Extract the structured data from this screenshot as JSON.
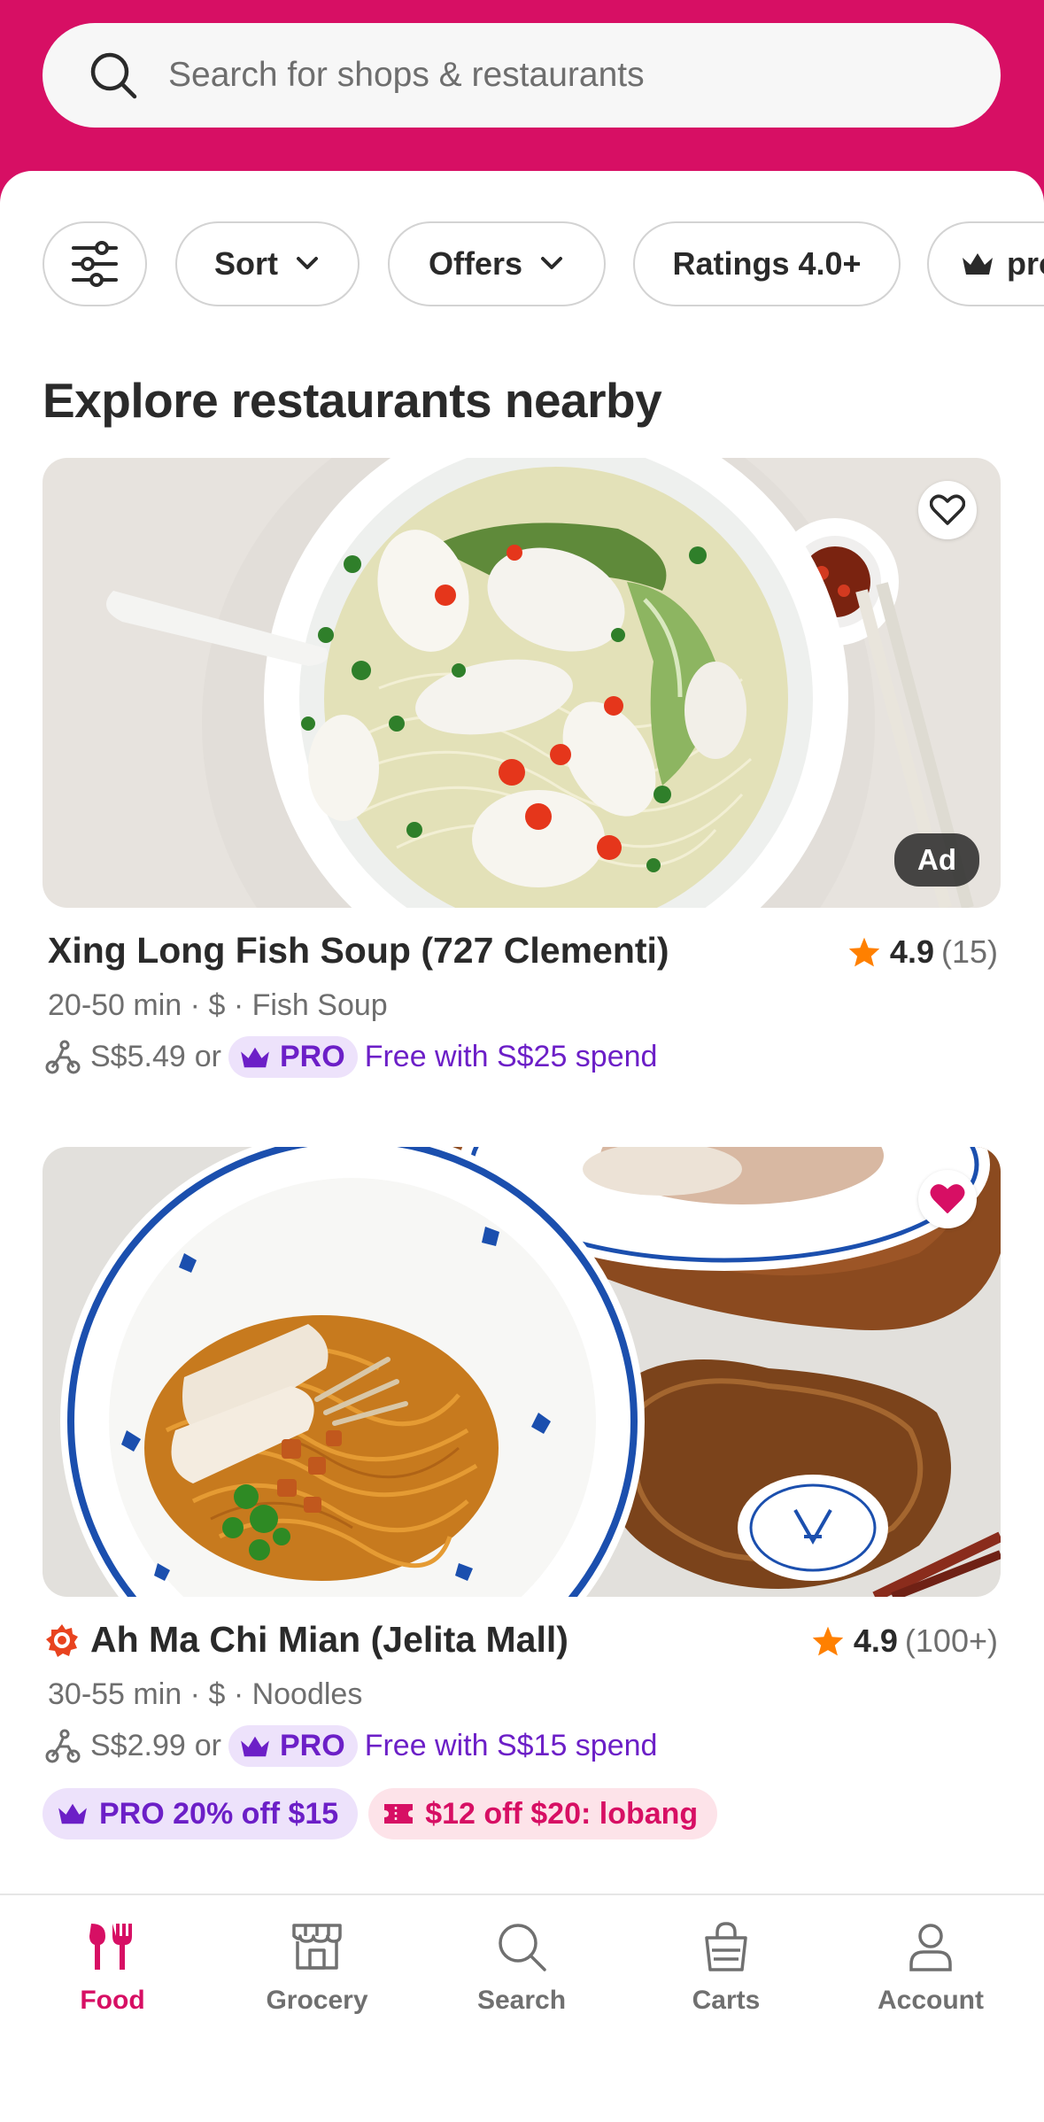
{
  "search": {
    "placeholder": "Search for shops & restaurants"
  },
  "filters": {
    "sort_label": "Sort",
    "offers_label": "Offers",
    "ratings_label": "Ratings 4.0+",
    "pro_label": "pro"
  },
  "section_title": "Explore restaurants nearby",
  "restaurants": [
    {
      "name": "Xing Long Fish Soup (727 Clementi)",
      "rating": "4.9",
      "rating_count": "(15)",
      "time": "20-50 min",
      "price": "$",
      "cuisine": "Fish Soup",
      "delivery_fee": "S$5.49",
      "or_text": "or",
      "pro_label": "PRO",
      "pro_offer": "Free with S$25 spend",
      "ad_label": "Ad",
      "favorited": false
    },
    {
      "name": "Ah Ma Chi Mian (Jelita Mall)",
      "rating": "4.9",
      "rating_count": "(100+)",
      "time": "30-55 min",
      "price": "$",
      "cuisine": "Noodles",
      "delivery_fee": "S$2.99",
      "or_text": "or",
      "pro_label": "PRO",
      "pro_offer": "Free with S$15 spend",
      "favorited": true,
      "tags": [
        "PRO 20% off $15",
        "$12 off $20: lobang"
      ]
    }
  ],
  "nav": {
    "food": "Food",
    "grocery": "Grocery",
    "search": "Search",
    "carts": "Carts",
    "account": "Account"
  },
  "colors": {
    "brand": "#d70f64",
    "pro": "#6c1fc7",
    "star": "#ff8000"
  }
}
